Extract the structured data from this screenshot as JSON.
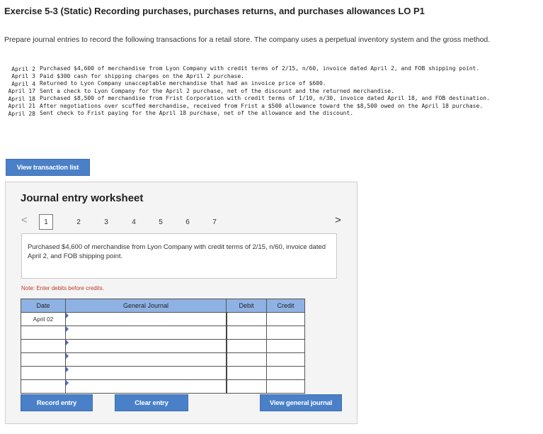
{
  "header": {
    "title": "Exercise 5-3 (Static) Recording purchases, purchases returns, and purchases allowances LO P1",
    "intro": "Prepare journal entries to record the following transactions for a retail store. The company uses a perpetual inventory system and the gross method."
  },
  "transactions": [
    {
      "date": "April 2",
      "text": "Purchased $4,600 of merchandise from Lyon Company with credit terms of 2/15, n/60, invoice dated April 2, and FOB shipping point."
    },
    {
      "date": "April 3",
      "text": "Paid $300 cash for shipping charges on the April 2 purchase."
    },
    {
      "date": "April 4",
      "text": "Returned to Lyon Company unacceptable merchandise that had an invoice price of $600."
    },
    {
      "date": "April 17",
      "text": "Sent a check to Lyon Company for the April 2 purchase, net of the discount and the returned merchandise."
    },
    {
      "date": "April 18",
      "text": "Purchased $8,500 of merchandise from Frist Corporation with credit terms of 1/10, n/30, invoice dated April 18, and FOB destination."
    },
    {
      "date": "April 21",
      "text": "After negotiations over scuffed merchandise, received from Frist a $500 allowance toward the $8,500 owed on the April 18 purchase."
    },
    {
      "date": "April 28",
      "text": "Sent check to Frist paying for the April 18 purchase, net of the allowance and the discount."
    }
  ],
  "buttons": {
    "view_transaction_list": "View transaction list",
    "record_entry": "Record entry",
    "clear_entry": "Clear entry",
    "view_general_journal": "View general journal"
  },
  "worksheet": {
    "title": "Journal entry worksheet",
    "prev_arrow": "<",
    "next_arrow": ">",
    "tabs": [
      "1",
      "2",
      "3",
      "4",
      "5",
      "6",
      "7"
    ],
    "active_tab": "1",
    "description": "Purchased $4,600 of merchandise from Lyon Company with credit terms of 2/15, n/60, invoice dated April 2, and FOB shipping point.",
    "note": "Note: Enter debits before credits.",
    "columns": {
      "date": "Date",
      "general_journal": "General Journal",
      "debit": "Debit",
      "credit": "Credit"
    },
    "first_date": "April 02"
  },
  "colors": {
    "button_blue": "#4a80c8",
    "header_blue": "#8fb2e4",
    "note_red": "#c0392b"
  }
}
